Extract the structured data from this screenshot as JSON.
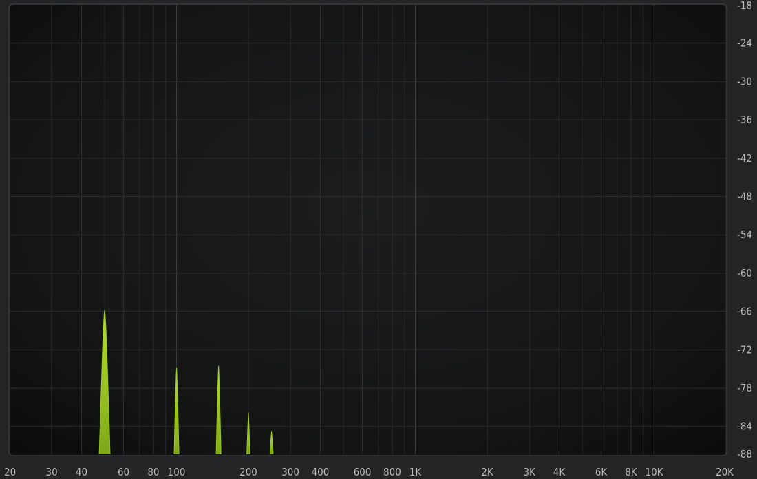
{
  "chart_data": {
    "type": "area",
    "xscale": "log",
    "xlim": [
      20,
      20000
    ],
    "ylim": [
      -88,
      -18
    ],
    "x_ticks": [
      {
        "value": 20,
        "label": "20"
      },
      {
        "value": 30,
        "label": "30"
      },
      {
        "value": 40,
        "label": "40"
      },
      {
        "value": 60,
        "label": "60"
      },
      {
        "value": 80,
        "label": "80"
      },
      {
        "value": 100,
        "label": "100"
      },
      {
        "value": 200,
        "label": "200"
      },
      {
        "value": 300,
        "label": "300"
      },
      {
        "value": 400,
        "label": "400"
      },
      {
        "value": 600,
        "label": "600"
      },
      {
        "value": 800,
        "label": "800"
      },
      {
        "value": 1000,
        "label": "1K"
      },
      {
        "value": 2000,
        "label": "2K"
      },
      {
        "value": 3000,
        "label": "3K"
      },
      {
        "value": 4000,
        "label": "4K"
      },
      {
        "value": 6000,
        "label": "6K"
      },
      {
        "value": 8000,
        "label": "8K"
      },
      {
        "value": 10000,
        "label": "10K"
      },
      {
        "value": 20000,
        "label": "20K"
      }
    ],
    "y_ticks": [
      -18,
      -24,
      -30,
      -36,
      -42,
      -48,
      -54,
      -60,
      -66,
      -72,
      -78,
      -84,
      -88
    ],
    "grid": true,
    "series": [
      {
        "color": "#9fcf1e",
        "peaks": [
          {
            "freq": 50,
            "level": -65.8
          },
          {
            "freq": 100,
            "level": -74.8
          },
          {
            "freq": 150,
            "level": -74.5
          },
          {
            "freq": 200,
            "level": -81.8
          },
          {
            "freq": 250,
            "level": -84.7
          }
        ]
      }
    ]
  }
}
